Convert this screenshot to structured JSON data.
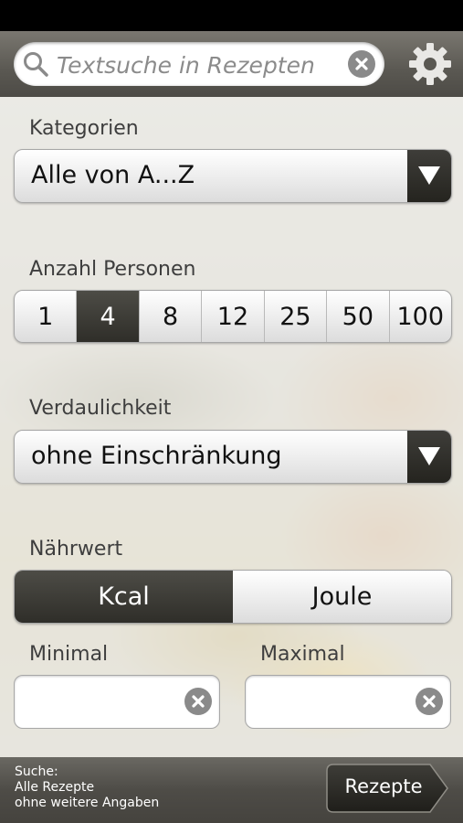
{
  "search": {
    "placeholder": "Textsuche in Rezepten",
    "value": ""
  },
  "sections": {
    "kategorien": {
      "label": "Kategorien",
      "selected": "Alle von A...Z"
    },
    "anzahl_personen": {
      "label": "Anzahl Personen",
      "options": [
        "1",
        "4",
        "8",
        "12",
        "25",
        "50",
        "100"
      ],
      "selected": "4"
    },
    "verdaulichkeit": {
      "label": "Verdaulichkeit",
      "selected": "ohne Einschränkung"
    },
    "naehrwert": {
      "label": "Nährwert",
      "options": [
        "Kcal",
        "Joule"
      ],
      "selected": "Kcal"
    },
    "minimal": {
      "label": "Minimal",
      "value": ""
    },
    "maximal": {
      "label": "Maximal",
      "value": ""
    }
  },
  "footer": {
    "summary_lines": [
      "Suche:",
      "Alle Rezepte",
      "ohne weitere Angaben"
    ],
    "button_label": "Rezepte"
  },
  "colors": {
    "bar_dark": "#4d4b46",
    "active_segment": "#3a3934",
    "label_text": "#3e3e3e"
  },
  "icons": {
    "search": "magnifier-icon",
    "clear": "clear-x-icon",
    "settings": "gear-icon",
    "dropdown": "triangle-down-icon"
  }
}
